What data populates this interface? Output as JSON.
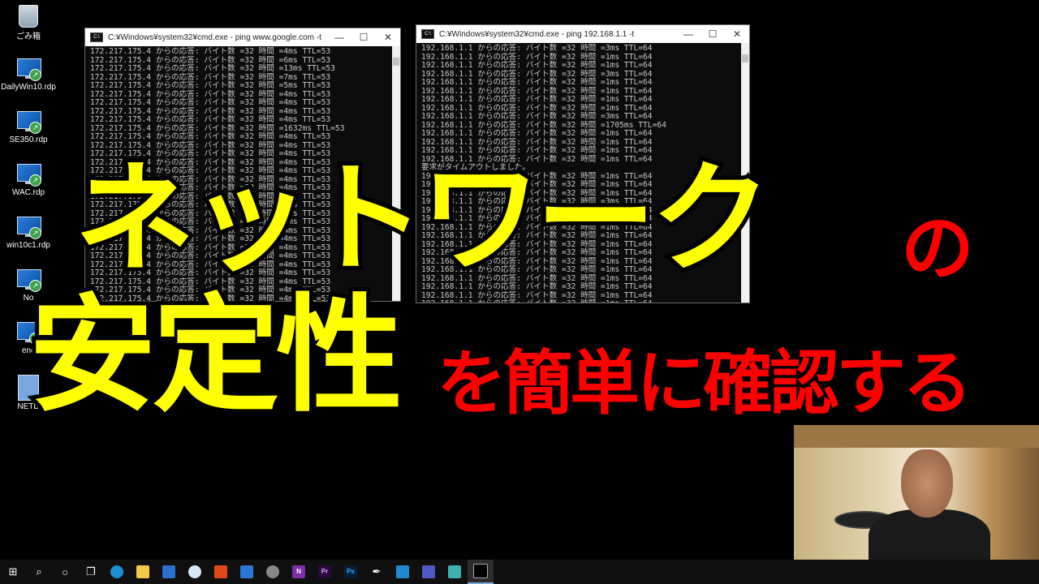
{
  "desktop": {
    "icons": [
      {
        "label": "ごみ箱"
      },
      {
        "label": "DailyWin10.rdp"
      },
      {
        "label": "SE350.rdp"
      },
      {
        "label": "WAC.rdp"
      },
      {
        "label": "win10c1.rdp"
      },
      {
        "label": "No"
      },
      {
        "label": "enc"
      },
      {
        "label": "NETD"
      }
    ]
  },
  "window_left": {
    "title": "C:¥Windows¥system32¥cmd.exe - ping  www.google.com -t",
    "lines": [
      "172.217.175.4 からの応答: バイト数 =32 時間 =4ms TTL=53",
      "172.217.175.4 からの応答: バイト数 =32 時間 =6ms TTL=53",
      "172.217.175.4 からの応答: バイト数 =32 時間 =13ms TTL=53",
      "172.217.175.4 からの応答: バイト数 =32 時間 =7ms TTL=53",
      "172.217.175.4 からの応答: バイト数 =32 時間 =5ms TTL=53",
      "172.217.175.4 からの応答: バイト数 =32 時間 =4ms TTL=53",
      "172.217.175.4 からの応答: バイト数 =32 時間 =4ms TTL=53",
      "172.217.175.4 からの応答: バイト数 =32 時間 =4ms TTL=53",
      "172.217.175.4 からの応答: バイト数 =32 時間 =4ms TTL=53",
      "172.217.175.4 からの応答: バイト数 =32 時間 =1632ms TTL=53",
      "172.217.175.4 からの応答: バイト数 =32 時間 =4ms TTL=53",
      "172.217.175.4 からの応答: バイト数 =32 時間 =4ms TTL=53",
      "172.217.175.4 からの応答: バイト数 =32 時間 =4ms TTL=53",
      "172.217.175.4 からの応答: バイト数 =32 時間 =4ms TTL=53",
      "172.217.175.4 からの応答: バイト数 =32 時間 =4ms TTL=53",
      "172.217.175.4 からの応答: バイト数 =32 時間 =4ms TTL=53",
      "172.217.175.4 からの応答: バイト数 =32 時間 =4ms TTL=53",
      "172.217.175.4 からの応答: バイト数 =32 時間 =4ms TTL=53",
      "172.217.175.4 からの応答: バイト数 =32 時間 =4ms TTL=53",
      "172.217.175.4 からの応答: バイト数 =32 時間 =4ms TTL=53",
      "172.217.175.4 からの応答: バイト数 =32 時間 =4ms TTL=53",
      "172.217.175.4 からの応答: バイト数 =32 時間 =4ms TTL=53",
      "172.217.175.4 からの応答: バイト数 =32 時間 =4ms TTL=53",
      "172.217.175.4 からの応答: バイト数 =32 時間 =4ms TTL=53",
      "172.217.175.4 からの応答: バイト数 =32 時間 =4ms TTL=53",
      "172.217.175.4 からの応答: バイト数 =32 時間 =4ms TTL=53",
      "172.217.175.4 からの応答: バイト数 =32 時間 =4ms TTL=53",
      "172.217.175.4 からの応答: バイト数 =32 時間 =4ms TTL=53",
      "172.217.175.4 からの応答: バイト数 =32 時間 =4ms TTL=53",
      "172.217.175.4 からの応答: バイト数 =32 時間 =4ms TTL=53",
      "172.217.175.4 からの応答: バイト数 =32 時間 =4ms TTL=53"
    ]
  },
  "window_right": {
    "title": "C:¥Windows¥system32¥cmd.exe - ping  192.168.1.1 -t",
    "lines": [
      "192.168.1.1 からの応答: バイト数 =32 時間 =3ms TTL=64",
      "192.168.1.1 からの応答: バイト数 =32 時間 =1ms TTL=64",
      "192.168.1.1 からの応答: バイト数 =32 時間 =1ms TTL=64",
      "192.168.1.1 からの応答: バイト数 =32 時間 =3ms TTL=64",
      "192.168.1.1 からの応答: バイト数 =32 時間 =1ms TTL=64",
      "192.168.1.1 からの応答: バイト数 =32 時間 =1ms TTL=64",
      "192.168.1.1 からの応答: バイト数 =32 時間 =1ms TTL=64",
      "192.168.1.1 からの応答: バイト数 =32 時間 =1ms TTL=64",
      "192.168.1.1 からの応答: バイト数 =32 時間 =3ms TTL=64",
      "192.168.1.1 からの応答: バイト数 =32 時間 =1705ms TTL=64",
      "192.168.1.1 からの応答: バイト数 =32 時間 =1ms TTL=64",
      "192.168.1.1 からの応答: バイト数 =32 時間 =1ms TTL=64",
      "192.168.1.1 からの応答: バイト数 =32 時間 =1ms TTL=64",
      "192.168.1.1 からの応答: バイト数 =32 時間 =1ms TTL=64",
      "要求がタイムアウトしました。",
      "192.168.1.1 からの応答: バイト数 =32 時間 =1ms TTL=64",
      "192.168.1.1 からの応答: バイト数 =32 時間 =1ms TTL=64",
      "192.168.1.1 からの応答: バイト数 =32 時間 =1ms TTL=64",
      "192.168.1.1 からの応答: バイト数 =32 時間 =3ms TTL=64",
      "192.168.1.1 からの応答: バイト数 =32 時間 =1ms TTL=64",
      "192.168.1.1 からの応答: バイト数 =32 時間 =1ms TTL=64",
      "192.168.1.1 からの応答: バイト数 =32 時間 =1ms TTL=64",
      "192.168.1.1 からの応答: バイト数 =32 時間 =1ms TTL=64",
      "192.168.1.1 からの応答: バイト数 =32 時間 =1ms TTL=64",
      "192.168.1.1 からの応答: バイト数 =32 時間 =1ms TTL=64",
      "192.168.1.1 からの応答: バイト数 =32 時間 =1ms TTL=64",
      "192.168.1.1 からの応答: バイト数 =32 時間 =1ms TTL=64",
      "192.168.1.1 からの応答: バイト数 =32 時間 =1ms TTL=64",
      "192.168.1.1 からの応答: バイト数 =32 時間 =1ms TTL=64",
      "192.168.1.1 からの応答: バイト数 =32 時間 =1ms TTL=64",
      "192.168.1.1 からの応答: バイト数 =32 時間 =1ms TTL=64"
    ]
  },
  "overlay": {
    "line1": "ネットワーク",
    "no": "の",
    "line2": "安定性",
    "line2_red": "を簡単に確認する",
    "yellow": "#ffff00",
    "red": "#ff0000"
  },
  "taskbar": {
    "items": [
      {
        "icon": "windows-start-icon"
      },
      {
        "icon": "search-icon"
      },
      {
        "icon": "cortana-icon"
      },
      {
        "icon": "task-view-icon"
      },
      {
        "icon": "edge-icon"
      },
      {
        "icon": "file-explorer-icon"
      },
      {
        "icon": "calendar-icon"
      },
      {
        "icon": "settings-icon"
      },
      {
        "icon": "office-icon"
      },
      {
        "icon": "remote-desktop-icon"
      },
      {
        "icon": "chrome-icon"
      },
      {
        "icon": "onenote-icon",
        "label": "N"
      },
      {
        "icon": "premiere-icon",
        "label": "Pr"
      },
      {
        "icon": "photoshop-icon",
        "label": "Ps"
      },
      {
        "icon": "pen-icon"
      },
      {
        "icon": "vscode-icon"
      },
      {
        "icon": "teams-icon"
      },
      {
        "icon": "edit-icon"
      },
      {
        "icon": "cmd-icon"
      }
    ]
  }
}
